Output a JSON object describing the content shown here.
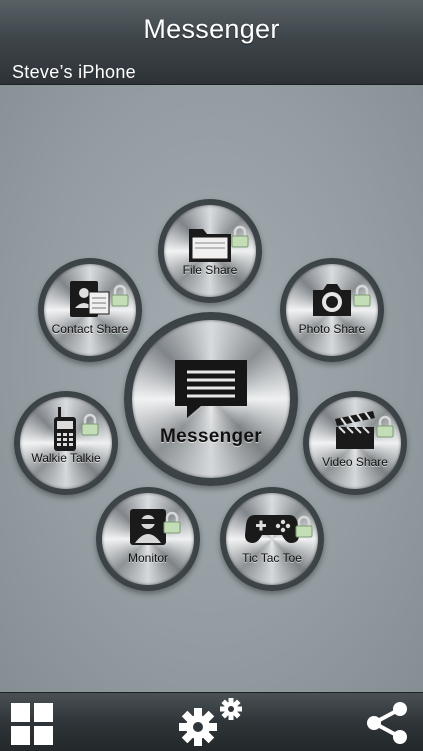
{
  "header": {
    "title": "Messenger",
    "device_name": "Steve’s iPhone"
  },
  "hubs": {
    "center": {
      "label": "Messenger",
      "icon": "chat-bubble-icon"
    },
    "file_share": {
      "label": "File Share",
      "icon": "folder-icon"
    },
    "contact_share": {
      "label": "Contact Share",
      "icon": "contact-card-icon"
    },
    "photo_share": {
      "label": "Photo Share",
      "icon": "camera-icon"
    },
    "walkie_talkie": {
      "label": "Walkie Talkie",
      "icon": "walkie-talkie-icon"
    },
    "video_share": {
      "label": "Video Share",
      "icon": "clapperboard-icon"
    },
    "monitor": {
      "label": "Monitor",
      "icon": "monitor-person-icon"
    },
    "tic_tac_toe": {
      "label": "Tic Tac Toe",
      "icon": "gamepad-icon"
    }
  },
  "toolbar": {
    "left_icon": "grid-icon",
    "center_icon": "settings-gears-icon",
    "right_icon": "share-icon"
  }
}
